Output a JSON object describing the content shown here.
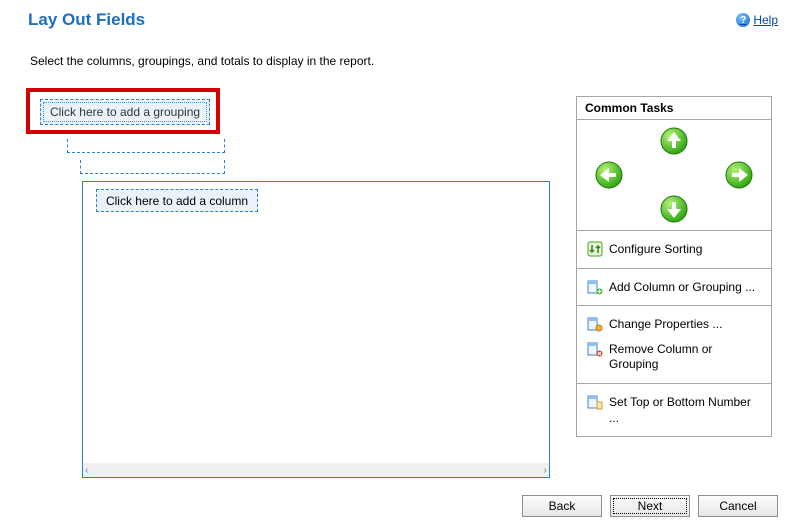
{
  "header": {
    "title": "Lay Out Fields",
    "help_label": "Help"
  },
  "instruction": "Select the columns, groupings, and totals to display in the report.",
  "grouping": {
    "placeholder": "Click here to add a grouping"
  },
  "column": {
    "placeholder": "Click here to add a column"
  },
  "tasks": {
    "header": "Common Tasks",
    "configure_sorting": "Configure Sorting",
    "add_column": "Add Column or Grouping ...",
    "change_properties": "Change Properties ...",
    "remove_column": "Remove Column or Grouping",
    "set_top_bottom": "Set Top or Bottom Number ..."
  },
  "buttons": {
    "back": "Back",
    "next": "Next",
    "cancel": "Cancel"
  }
}
